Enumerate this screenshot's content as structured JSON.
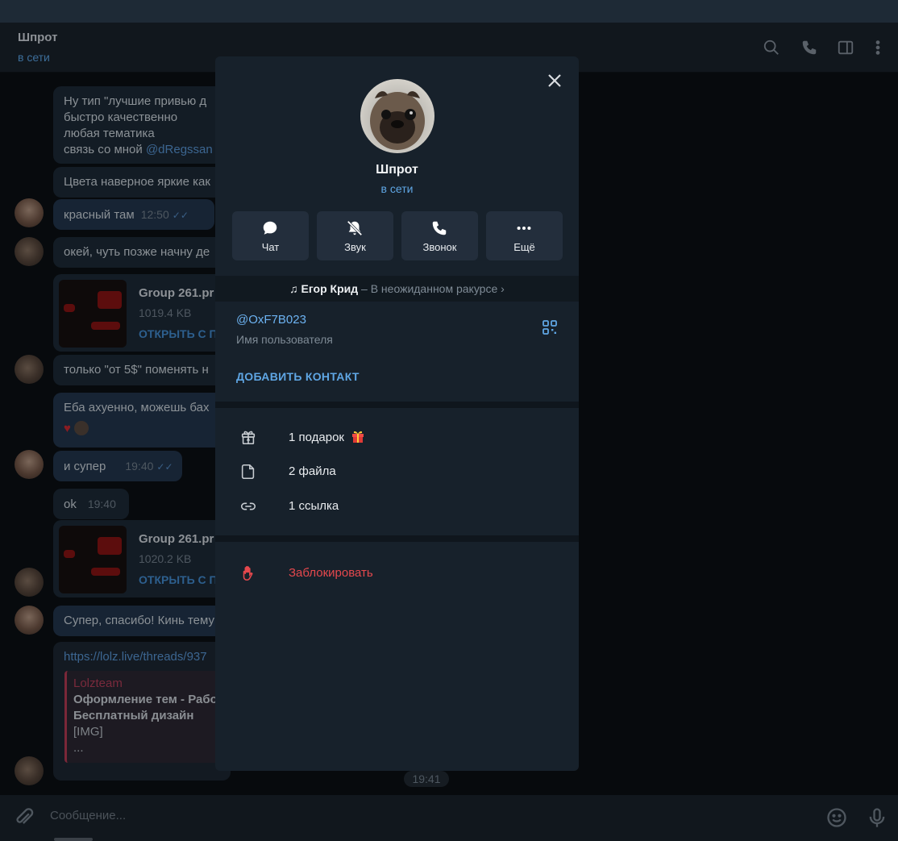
{
  "chat": {
    "title": "Шпрот",
    "status": "в сети"
  },
  "messages": {
    "m1_line1": "Ну тип \"лучшие привью д",
    "m1_line2": "быстро качественно",
    "m1_line3": "любая тематика",
    "m1_line4_prefix": "связь со мной ",
    "m1_line4_link": "@dRegssan",
    "m2": "Цвета наверное яркие как",
    "m3": "красный там",
    "m3_time": "12:50",
    "m4": "окей, чуть позже начну де",
    "file1_name": "Group 261.pr",
    "file1_size": "1019.4 KB",
    "file1_open": "ОТКРЫТЬ С П",
    "m5": "только \"от 5$\" поменять н",
    "m6": "Еба ахуенно, можешь бах",
    "m7": "и супер",
    "m7_time": "19:40",
    "m8": "ok",
    "m8_time": "19:40",
    "file2_name": "Group 261.pr",
    "file2_size": "1020.2 KB",
    "file2_open": "ОТКРЫТЬ С П",
    "m9": "Супер, спасибо! Кинь тему",
    "m10_link": "https://lolz.live/threads/937",
    "quote_title": "Lolzteam",
    "quote_line1": "Оформление тем - Рабо",
    "quote_line2": "Бесплатный дизайн",
    "quote_line3": "[IMG]",
    "quote_line4": "...",
    "last_time": "19:41"
  },
  "composer": {
    "placeholder": "Сообщение..."
  },
  "profile": {
    "name": "Шпрот",
    "status": "в сети",
    "actions": [
      {
        "label": "Чат",
        "icon": "chat-icon"
      },
      {
        "label": "Звук",
        "icon": "mute-bell-icon"
      },
      {
        "label": "Звонок",
        "icon": "phone-icon"
      },
      {
        "label": "Ещё",
        "icon": "more-icon"
      }
    ],
    "music": {
      "note": "♫",
      "artist": "Егор Крид",
      "separator": " – ",
      "track": "В неожиданном ракурсе",
      "chevron": "›"
    },
    "username": "@OxF7B023",
    "username_label": "Имя пользователя",
    "add_contact": "ДОБАВИТЬ КОНТАКТ",
    "media_rows": [
      {
        "label": "1 подарок",
        "icon": "gift-icon"
      },
      {
        "label": "2 файла",
        "icon": "file-icon"
      },
      {
        "label": "1 ссылка",
        "icon": "link-icon"
      }
    ],
    "block": "Заблокировать"
  },
  "colors": {
    "modal_bg": "#17212b",
    "accent": "#5fa6e4",
    "danger": "#e5484d",
    "button_bg": "#232e3c"
  }
}
